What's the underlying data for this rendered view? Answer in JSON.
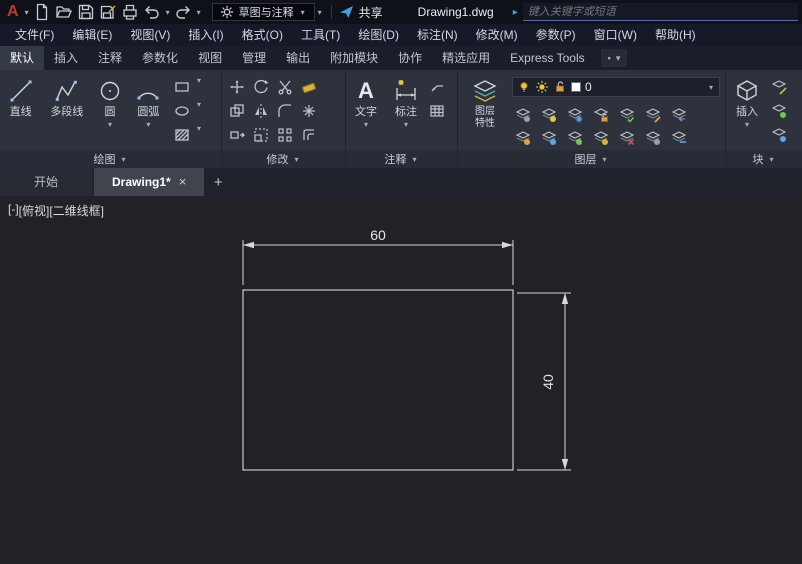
{
  "icons": {
    "caret": "▾",
    "dot": "▪",
    "arrow_right": "▸"
  },
  "titlebar": {
    "app_initial": "A",
    "workspace": "草图与注释",
    "share_label": "共享",
    "filename": "Drawing1.dwg",
    "search_placeholder": "键入关键字或短语"
  },
  "menubar": {
    "items": [
      "文件(F)",
      "编辑(E)",
      "视图(V)",
      "插入(I)",
      "格式(O)",
      "工具(T)",
      "绘图(D)",
      "标注(N)",
      "修改(M)",
      "参数(P)",
      "窗口(W)",
      "帮助(H)"
    ]
  },
  "ribbon": {
    "tabs": [
      "默认",
      "插入",
      "注释",
      "参数化",
      "视图",
      "管理",
      "输出",
      "附加模块",
      "协作",
      "精选应用",
      "Express Tools"
    ],
    "active_tab": "默认",
    "draw": {
      "label": "绘图",
      "line": "直线",
      "polyline": "多段线",
      "circle": "圆",
      "arc": "圆弧"
    },
    "modify": {
      "label": "修改"
    },
    "annotate": {
      "label": "注释",
      "text": "文字",
      "dim": "标注"
    },
    "layers": {
      "label": "图层",
      "properties_line1": "图层",
      "properties_line2": "特性",
      "current_layer": "0"
    },
    "block": {
      "label": "块",
      "insert": "插入"
    }
  },
  "filetabs": {
    "start": "开始",
    "active": "Drawing1*",
    "close": "×",
    "add": "+"
  },
  "viewport": {
    "controls": [
      "[-]",
      "[俯视]",
      "[二维线框]"
    ]
  },
  "canvas": {
    "dim_width": "60",
    "dim_height": "40"
  }
}
